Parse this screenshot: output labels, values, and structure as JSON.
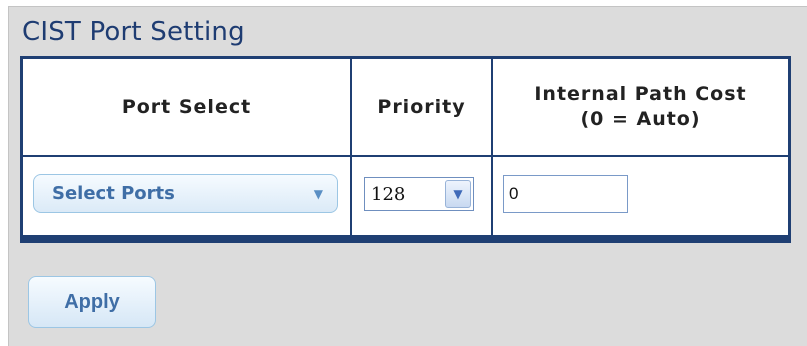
{
  "section": {
    "title": "CIST Port Setting"
  },
  "table": {
    "headers": {
      "port_select": "Port Select",
      "priority": "Priority",
      "internal_path_cost_line1": "Internal Path Cost",
      "internal_path_cost_line2": "(0 = Auto)"
    },
    "row": {
      "port_select": {
        "label": "Select Ports",
        "icon": "dropdown-arrow"
      },
      "priority": {
        "value": "128",
        "icon": "chevron-down"
      },
      "internal_path_cost": {
        "value": "0"
      }
    }
  },
  "actions": {
    "apply_label": "Apply"
  },
  "colors": {
    "panel_bg": "#dcdcdc",
    "border_navy": "#1f3f73",
    "title_text": "#1e3c72",
    "button_text": "#3f6ea6"
  }
}
